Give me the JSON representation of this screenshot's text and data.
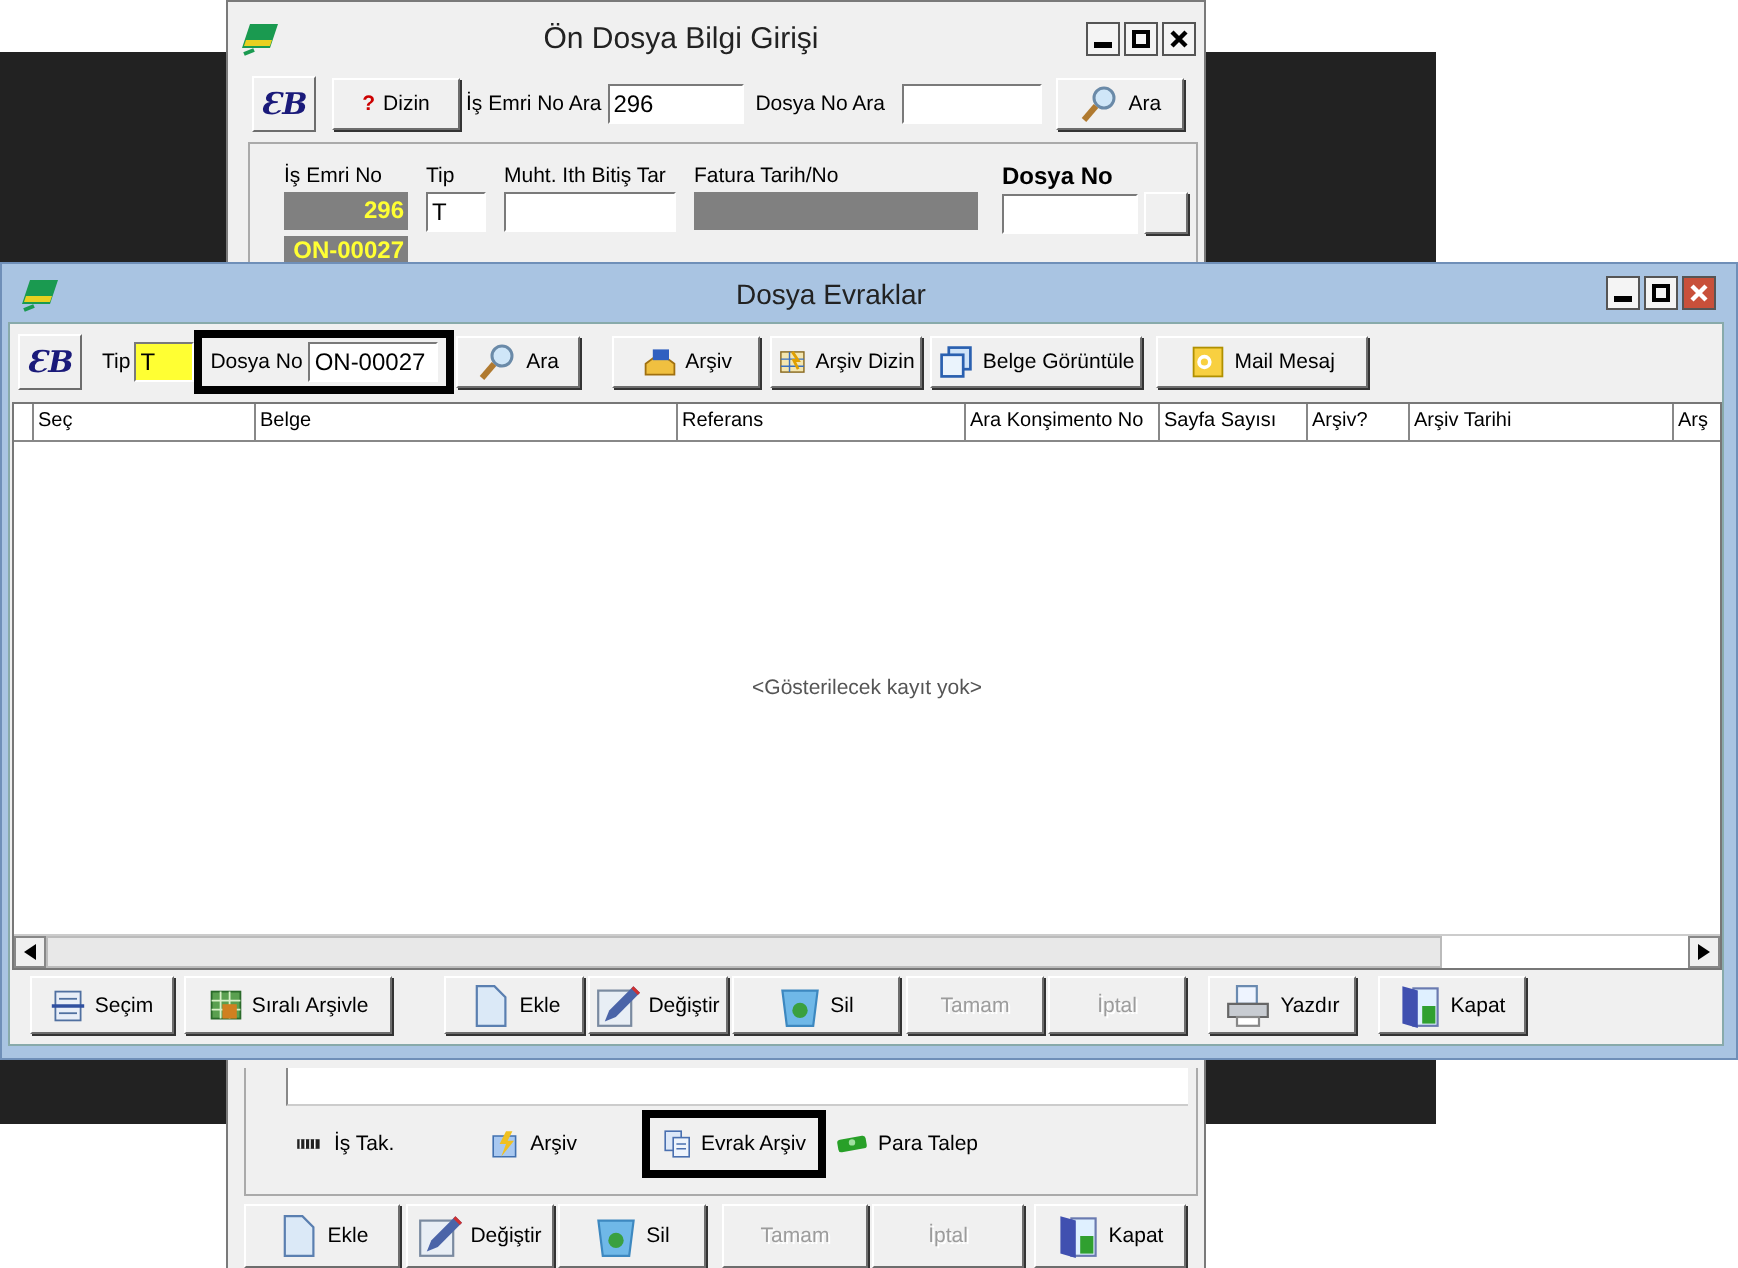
{
  "back_window": {
    "title": "Ön Dosya Bilgi Girişi",
    "logo_button": "ƐB",
    "toolbar": {
      "index_mark": "?",
      "index_button": "Dizin",
      "job_search_label": "İş Emri No Ara",
      "job_search_value": "296",
      "file_search_label": "Dosya No Ara",
      "search_button": "Ara"
    },
    "fields": [
      {
        "label": "İş Emri No",
        "value": "296",
        "kind": "readonly"
      },
      {
        "label": "Tip",
        "value": "T",
        "kind": "input"
      },
      {
        "label": "Muht. Ith Bitiş Tar",
        "kind": "input"
      },
      {
        "label": "Fatura Tarih/No",
        "kind": "readonly"
      },
      {
        "label": "Dosya No",
        "kind": "lookup"
      }
    ],
    "file_badge": "ON-00027",
    "links": [
      {
        "label": "İş Tak.",
        "highlighted": false
      },
      {
        "label": "Arşiv",
        "highlighted": false
      },
      {
        "label": "Evrak Arşiv",
        "highlighted": true
      },
      {
        "label": "Para Talep",
        "highlighted": false
      }
    ],
    "buttons": [
      {
        "label": "Ekle",
        "disabled": false
      },
      {
        "label": "Değiştir",
        "disabled": false
      },
      {
        "label": "Sil",
        "disabled": false
      },
      {
        "label": "Tamam",
        "disabled": true
      },
      {
        "label": "İptal",
        "disabled": true
      },
      {
        "label": "Kapat",
        "disabled": false
      }
    ]
  },
  "front_window": {
    "title": "Dosya Evraklar",
    "logo_button": "ƐB",
    "toolbar": {
      "type_label": "Tip",
      "type_value": "T",
      "file_label": "Dosya No",
      "file_value": "ON-00027",
      "file_highlighted": true,
      "buttons": [
        "Ara",
        "Arşiv",
        "Arşiv Dizin",
        "Belge Görüntüle",
        "Mail Mesaj"
      ]
    },
    "table": {
      "columns": [
        "Seç",
        "Belge",
        "Referans",
        "Ara Konşimento No",
        "Sayfa Sayısı",
        "Arşiv?",
        "Arşiv Tarihi",
        "Arş"
      ],
      "empty_message": "<Gösterilecek kayıt yok>"
    },
    "buttons": [
      {
        "label": "Seçim",
        "disabled": false
      },
      {
        "label": "Sıralı Arşivle",
        "disabled": false
      },
      {
        "label": "Ekle",
        "disabled": false
      },
      {
        "label": "Değiştir",
        "disabled": false
      },
      {
        "label": "Sil",
        "disabled": false
      },
      {
        "label": "Tamam",
        "disabled": true
      },
      {
        "label": "İptal",
        "disabled": true
      },
      {
        "label": "Yazdır",
        "disabled": false
      },
      {
        "label": "Kapat",
        "disabled": false
      }
    ]
  }
}
